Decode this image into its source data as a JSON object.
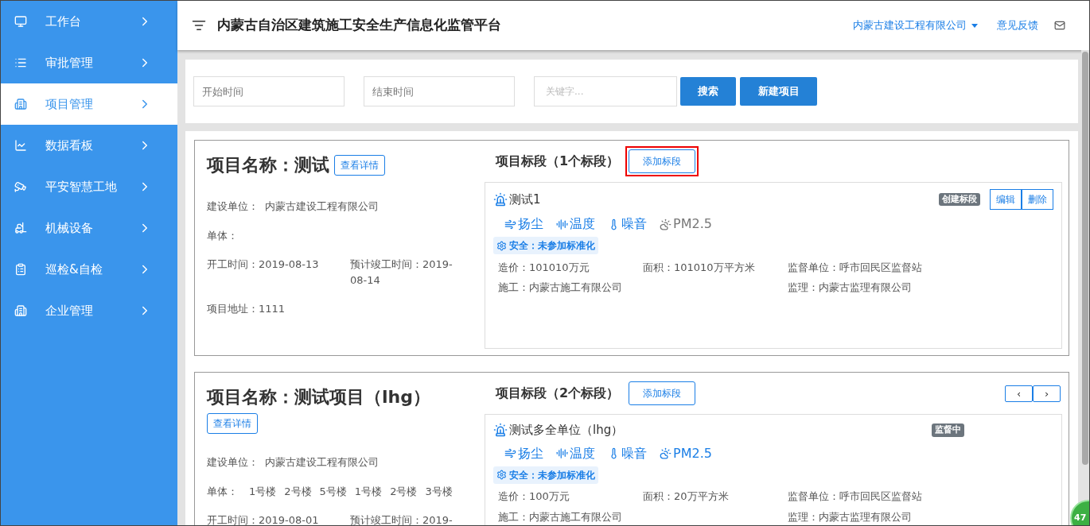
{
  "sidebar": {
    "items": [
      {
        "label": "工作台",
        "kind": "monitor",
        "selected": false
      },
      {
        "label": "审批管理",
        "kind": "list",
        "selected": false
      },
      {
        "label": "项目管理",
        "kind": "building",
        "selected": true
      },
      {
        "label": "数据看板",
        "kind": "chart",
        "selected": false
      },
      {
        "label": "平安智慧工地",
        "kind": "camera",
        "selected": false
      },
      {
        "label": "机械设备",
        "kind": "machine",
        "selected": false
      },
      {
        "label": "巡检&自检",
        "kind": "doc",
        "selected": false
      },
      {
        "label": "企业管理",
        "kind": "building",
        "selected": false
      }
    ]
  },
  "header": {
    "title": "内蒙古自治区建筑施工安全生产信息化监管平台",
    "company": "内蒙古建设工程有限公司",
    "feedback": "意见反馈"
  },
  "filters": {
    "start": {
      "placeholder": "开始时间"
    },
    "end": {
      "placeholder": "结束时间"
    },
    "keyword": {
      "placeholder": "关键字..."
    },
    "buttons": [
      "搜索",
      "新建项目"
    ]
  },
  "projects": [
    {
      "title": "项目名称：测试",
      "details_button": "查看详情",
      "fields": [
        {
          "text": "建设单位：  内蒙古建设工程有限公司"
        },
        {
          "text": "单体："
        },
        {
          "text": "开工时间：2019-08-13",
          "text2": "预计竣工时间：2019-08-14"
        },
        {
          "text": "项目地址：1111"
        }
      ],
      "sections_title": "项目标段（1个标段）",
      "add_button": "添加标段",
      "add_highlighted": true,
      "sections": [
        {
          "name": "测试1",
          "status": "创建标段",
          "actions": [
            "编辑",
            "删除"
          ],
          "sensors": [
            {
              "kind": "dust",
              "label": "扬尘",
              "online": true
            },
            {
              "kind": "temperature",
              "label": "温度",
              "online": true
            },
            {
              "kind": "noise",
              "label": "噪音",
              "online": true
            },
            {
              "kind": "pm",
              "label": "PM2.5",
              "online": false
            }
          ],
          "safety": "安全：未参加标准化",
          "info": [
            {
              "kind": "left",
              "text": "造价：101010万元"
            },
            {
              "kind": "middle",
              "text": "面积：101010万平方米"
            },
            {
              "kind": "right",
              "text": "监督单位：呼市回民区监督站"
            },
            {
              "kind": "left",
              "text": "施工：内蒙古施工有限公司"
            },
            {
              "kind": "right",
              "text": "监理：内蒙古监理有限公司"
            }
          ]
        }
      ]
    },
    {
      "title": "项目名称：测试项目（lhg）",
      "details_button": "查看详情",
      "fields": [
        {
          "text": "建设单位：  内蒙古建设工程有限公司"
        },
        {
          "text": "单体：",
          "units": [
            "1号楼",
            "2号楼",
            "5号楼",
            "1号楼",
            "2号楼",
            "3号楼"
          ]
        },
        {
          "text": "开工时间：2019-08-01",
          "text2": "预计竣工时间：2019-"
        }
      ],
      "sections_title": "项目标段（2个标段）",
      "add_button": "添加标段",
      "add_highlighted": false,
      "pager": [
        "‹",
        "›"
      ],
      "sections": [
        {
          "name": "测试多全单位（lhg）",
          "status": "监督中",
          "sensors": [
            {
              "kind": "dust",
              "label": "扬尘",
              "online": true
            },
            {
              "kind": "temperature",
              "label": "温度",
              "online": true
            },
            {
              "kind": "noise",
              "label": "噪音",
              "online": true
            },
            {
              "kind": "pm",
              "label": "PM2.5",
              "online": true
            }
          ],
          "safety": "安全：未参加标准化",
          "info": [
            {
              "kind": "left",
              "text": "造价：100万元"
            },
            {
              "kind": "middle",
              "text": "面积：20万平方米"
            },
            {
              "kind": "right",
              "text": "监督单位：呼市回民区监督站"
            },
            {
              "kind": "left",
              "text": "施工：内蒙古施工有限公司"
            },
            {
              "kind": "right",
              "text": "监理：内蒙古监理有限公司"
            }
          ]
        }
      ]
    }
  ],
  "floating_badge": "47"
}
